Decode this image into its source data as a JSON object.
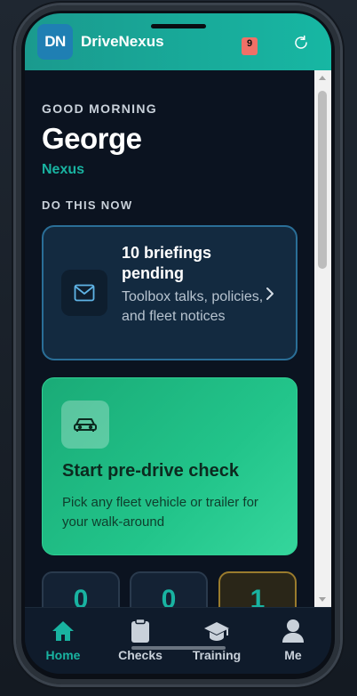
{
  "header": {
    "logo_text": "DN",
    "app_name": "DriveNexus",
    "notification_count": "9"
  },
  "greeting": {
    "label": "GOOD MORNING",
    "name": "George",
    "org": "Nexus"
  },
  "section": {
    "label": "DO THIS NOW"
  },
  "briefings_card": {
    "title": "10 briefings pending",
    "subtitle": "Toolbox talks, policies, and fleet notices"
  },
  "drive_card": {
    "title": "Start pre-drive check",
    "subtitle": "Pick any fleet vehicle or trailer for your walk-around"
  },
  "stats": [
    {
      "value": "0"
    },
    {
      "value": "0"
    },
    {
      "value": "1"
    }
  ],
  "tabs": [
    {
      "label": "Home",
      "icon": "home-icon",
      "active": true
    },
    {
      "label": "Checks",
      "icon": "clipboard-icon",
      "active": false
    },
    {
      "label": "Training",
      "icon": "graduation-cap-icon",
      "active": false
    },
    {
      "label": "Me",
      "icon": "user-icon",
      "active": false
    }
  ],
  "colors": {
    "accent": "#19b3a1",
    "header": "#17b7a3",
    "drive_card": "#22c48a",
    "badge": "#f07067",
    "background": "#0b1320"
  }
}
